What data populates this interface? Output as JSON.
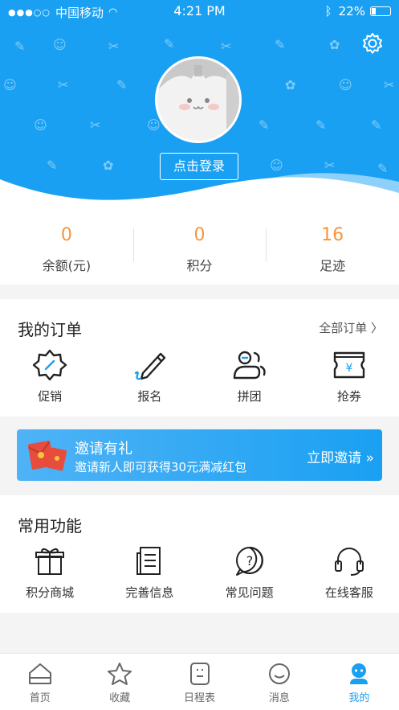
{
  "status_bar": {
    "carrier": "中国移动",
    "time": "4:21 PM",
    "battery": "22%"
  },
  "profile": {
    "login_label": "点击登录"
  },
  "stats": [
    {
      "value": "0",
      "label": "余额(元)"
    },
    {
      "value": "0",
      "label": "积分"
    },
    {
      "value": "16",
      "label": "足迹"
    }
  ],
  "orders": {
    "title": "我的订单",
    "more": "全部订单 〉",
    "items": [
      {
        "label": "促销",
        "icon": "promotion-icon"
      },
      {
        "label": "报名",
        "icon": "signup-pencil-icon"
      },
      {
        "label": "拼团",
        "icon": "group-buy-icon"
      },
      {
        "label": "抢券",
        "icon": "coupon-icon"
      }
    ]
  },
  "banner": {
    "title": "邀请有礼",
    "subtitle": "邀请新人即可获得30元满减红包",
    "cta": "立即邀请 »"
  },
  "features": {
    "title": "常用功能",
    "items": [
      {
        "label": "积分商城",
        "icon": "gift-icon"
      },
      {
        "label": "完善信息",
        "icon": "document-icon"
      },
      {
        "label": "常见问题",
        "icon": "question-icon"
      },
      {
        "label": "在线客服",
        "icon": "headset-icon"
      }
    ]
  },
  "tabs": [
    {
      "label": "首页",
      "icon": "home-icon"
    },
    {
      "label": "收藏",
      "icon": "star-icon"
    },
    {
      "label": "日程表",
      "icon": "calendar-icon"
    },
    {
      "label": "消息",
      "icon": "message-icon"
    },
    {
      "label": "我的",
      "icon": "profile-icon",
      "active": true
    }
  ],
  "colors": {
    "primary": "#1aa0f2",
    "accent": "#f7953a"
  }
}
